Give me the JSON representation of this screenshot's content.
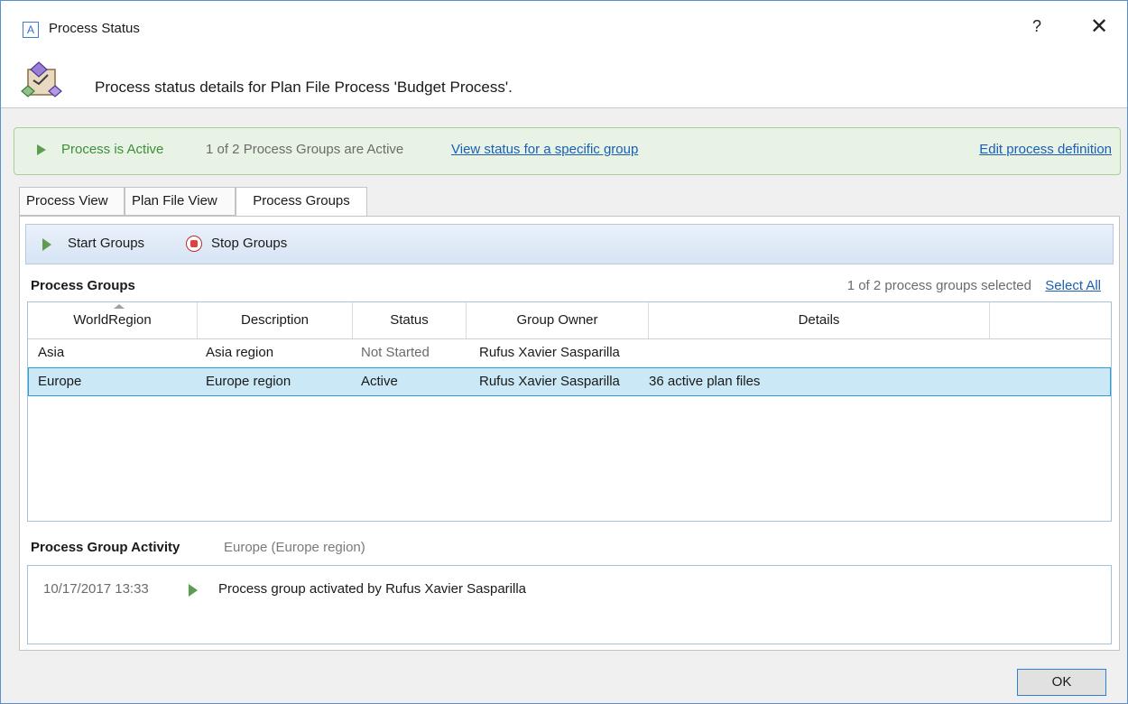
{
  "window": {
    "app_icon_letter": "A",
    "title": "Process Status",
    "help_label": "?",
    "close_label": "✕"
  },
  "header": {
    "icon": "process-diagram-icon",
    "text": "Process status details for Plan File Process 'Budget Process'."
  },
  "status_banner": {
    "status": "Process is Active",
    "groups_active": "1 of 2 Process Groups are Active",
    "view_status_link": "View status for a specific group",
    "edit_definition_link": "Edit process definition",
    "accent_color": "#3e8e3a"
  },
  "tabs": [
    {
      "label": "Process View",
      "active": false
    },
    {
      "label": "Plan File View",
      "active": false
    },
    {
      "label": "Process Groups",
      "active": true
    }
  ],
  "toolbar": {
    "start_label": "Start Groups",
    "stop_label": "Stop Groups"
  },
  "process_groups": {
    "title": "Process Groups",
    "selection_text": "1 of 2 process groups selected",
    "select_all_label": "Select All",
    "columns": [
      "WorldRegion",
      "Description",
      "Status",
      "Group Owner",
      "Details"
    ],
    "rows": [
      {
        "region": "Asia",
        "description": "Asia region",
        "status": "Not Started",
        "owner": "Rufus Xavier Sasparilla",
        "details": "",
        "selected": false
      },
      {
        "region": "Europe",
        "description": "Europe region",
        "status": "Active",
        "owner": "Rufus Xavier Sasparilla",
        "details": "36 active plan files",
        "selected": true
      }
    ]
  },
  "activity": {
    "title": "Process Group Activity",
    "subtitle": "Europe (Europe region)",
    "entries": [
      {
        "time": "10/17/2017 13:33",
        "message": "Process group activated by Rufus Xavier Sasparilla"
      }
    ]
  },
  "footer": {
    "ok_label": "OK"
  }
}
